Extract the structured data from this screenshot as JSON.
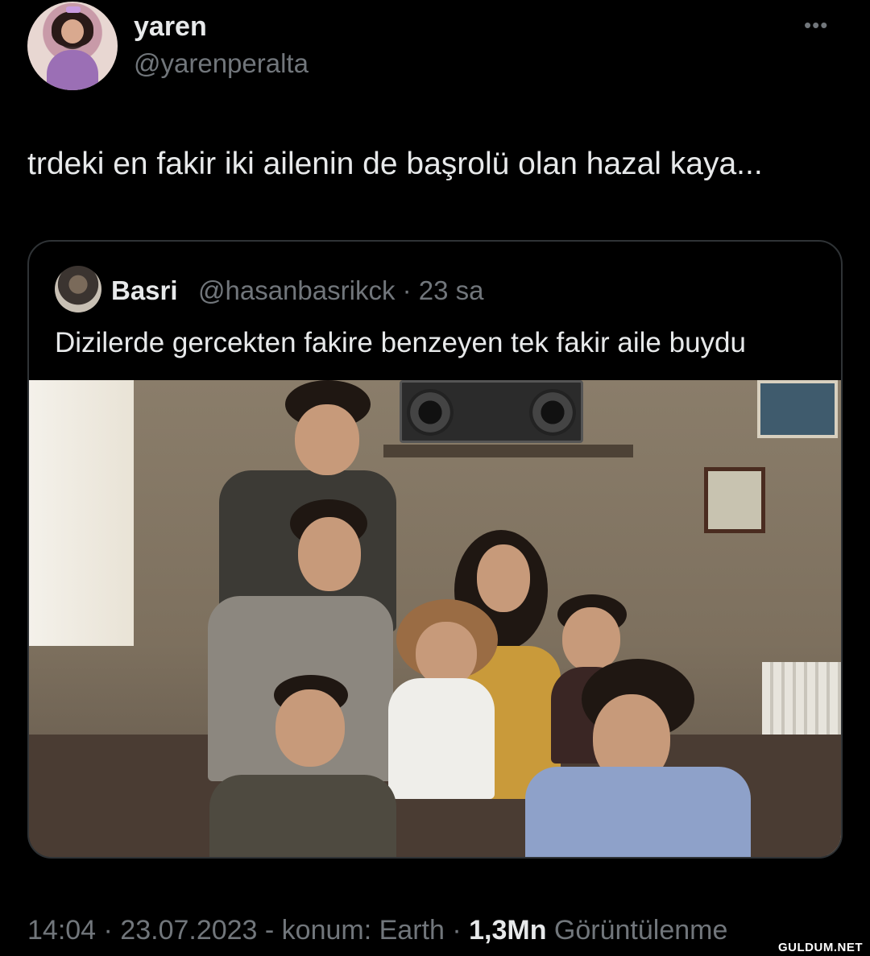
{
  "author": {
    "display_name": "yaren",
    "handle": "@yarenperalta"
  },
  "tweet": {
    "text": "trdeki en fakir iki ailenin de başrolü olan hazal kaya..."
  },
  "quoted_tweet": {
    "display_name": "Basri",
    "handle_time": "@hasanbasrikck · 23 sa",
    "text": "Dizilerde gercekten fakire benzeyen tek fakir aile buydu"
  },
  "footer": {
    "time_date": "14:04 · 23.07.2023 - konum: Earth · ",
    "views_count": "1,3Mn",
    "views_label": " Görüntülenme"
  },
  "watermark": "GULDUM.NET",
  "icons": {
    "more": "more-options-icon"
  },
  "colors": {
    "background": "#000000",
    "primary_text": "#e7e9ea",
    "secondary_text": "#71767b",
    "card_border": "#2f3336"
  }
}
